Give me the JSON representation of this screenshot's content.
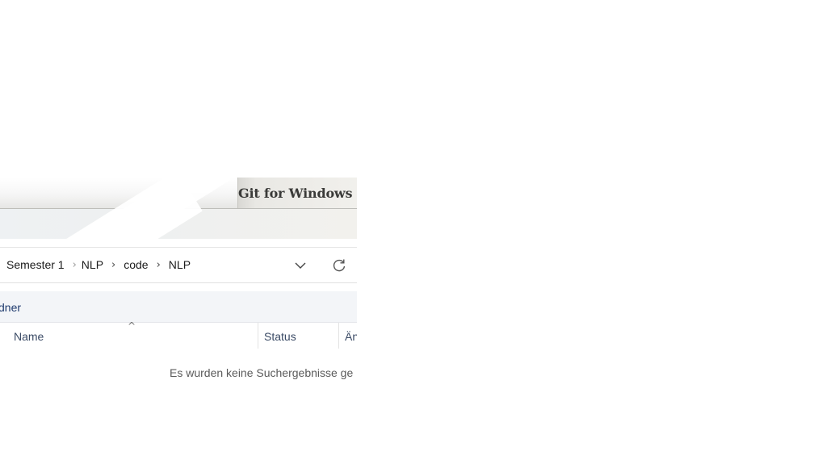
{
  "installer": {
    "title": "Git for Windows"
  },
  "explorer": {
    "breadcrumb": [
      "Semester 1",
      "NLP",
      "code",
      "NLP"
    ],
    "toolbar_item": "dner",
    "columns": {
      "name": "Name",
      "status": "Status",
      "modified": "Än"
    },
    "empty_message": "Es wurden keine Suchergebnisse ge",
    "icons": {
      "expand": "chevron-down-icon",
      "refresh": "refresh-icon",
      "sort": "sort-ascending-icon"
    }
  }
}
